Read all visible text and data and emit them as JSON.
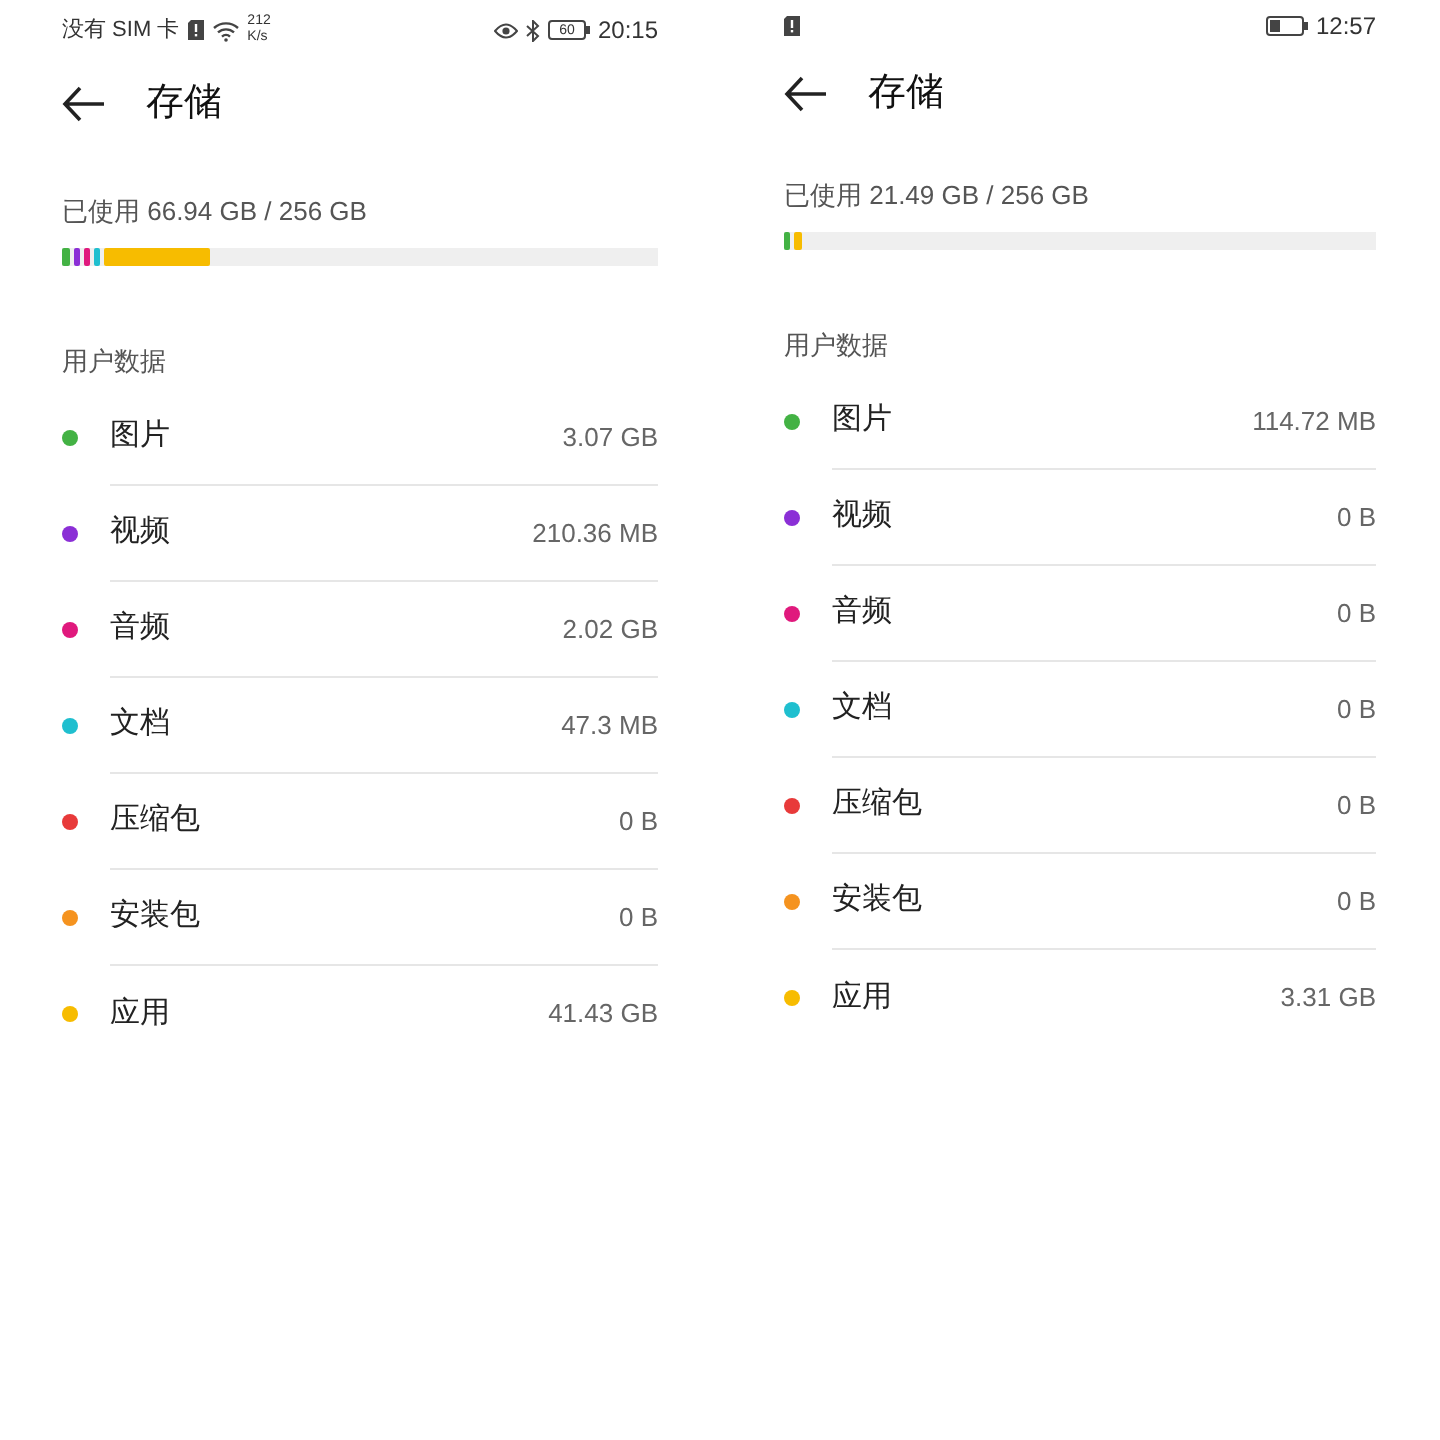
{
  "screens": [
    {
      "status_bar": {
        "left_text": "没有 SIM 卡",
        "speed_value": "212",
        "speed_unit": "K/s",
        "battery": "60",
        "time": "20:15",
        "sim_alert": true,
        "eye_comfort": true,
        "bluetooth": true,
        "wifi": true
      },
      "title": "存储",
      "used": "已使用 66.94 GB / 256 GB",
      "usage_segments": [
        {
          "color": "#43b244",
          "level": 0.013
        },
        {
          "color": "#8b2fd6",
          "level": 0.01
        },
        {
          "color": "#e0197d",
          "level": 0.01
        },
        {
          "color": "#1fbfcf",
          "level": 0.01
        },
        {
          "color": "#f7bc00",
          "level": 0.178
        }
      ],
      "section": "用户数据",
      "categories": [
        {
          "name": "图片",
          "size": "3.07 GB",
          "color": "#43b244"
        },
        {
          "name": "视频",
          "size": "210.36 MB",
          "color": "#8b2fd6"
        },
        {
          "name": "音频",
          "size": "2.02 GB",
          "color": "#e0197d"
        },
        {
          "name": "文档",
          "size": "47.3 MB",
          "color": "#1fbfcf"
        },
        {
          "name": "压缩包",
          "size": "0 B",
          "color": "#e83a3a"
        },
        {
          "name": "安装包",
          "size": "0 B",
          "color": "#f5931f"
        },
        {
          "name": "应用",
          "size": "41.43 GB",
          "color": "#f7bc00"
        }
      ]
    },
    {
      "status_bar": {
        "time": "12:57",
        "sim_alert": true
      },
      "title": "存储",
      "used": "已使用 21.49 GB / 256 GB",
      "usage_segments": [
        {
          "color": "#43b244",
          "level": 0.01
        },
        {
          "color": "#f7bc00",
          "level": 0.013
        }
      ],
      "section": "用户数据",
      "categories": [
        {
          "name": "图片",
          "size": "114.72 MB",
          "color": "#43b244"
        },
        {
          "name": "视频",
          "size": "0 B",
          "color": "#8b2fd6"
        },
        {
          "name": "音频",
          "size": "0 B",
          "color": "#e0197d"
        },
        {
          "name": "文档",
          "size": "0 B",
          "color": "#1fbfcf"
        },
        {
          "name": "压缩包",
          "size": "0 B",
          "color": "#e83a3a"
        },
        {
          "name": "安装包",
          "size": "0 B",
          "color": "#f5931f"
        },
        {
          "name": "应用",
          "size": "3.31 GB",
          "color": "#f7bc00"
        }
      ]
    }
  ]
}
